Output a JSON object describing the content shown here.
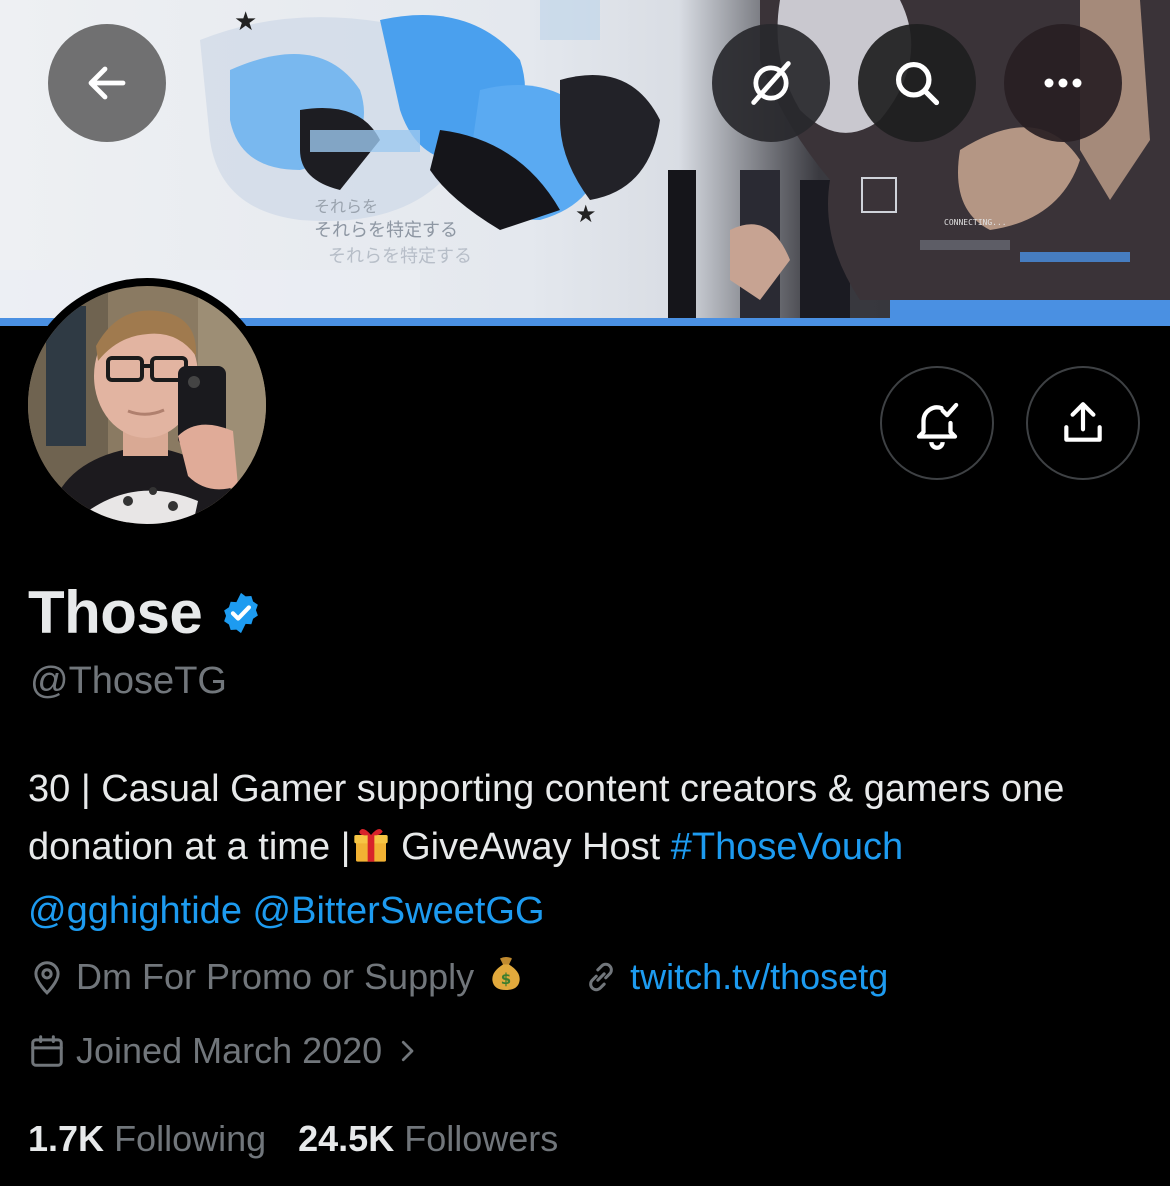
{
  "banner": {
    "graffiti_text": "THOSE",
    "japanese_lines": [
      "それらを",
      "それらを特定する",
      "それらを特定する"
    ],
    "connecting_text": "CONNECTING...",
    "accent_color": "#4a90e2"
  },
  "header_buttons": {
    "back": "arrow-left-icon",
    "grok": "grok-icon",
    "search": "search-icon",
    "more": "more-horizontal-icon"
  },
  "profile": {
    "display_name": "Those",
    "verified": true,
    "handle": "@ThoseTG",
    "bio": {
      "text1": "30 | Casual Gamer supporting content creators & gamers one donation at a time |",
      "text2": " GiveAway Host ",
      "hashtag": "#ThoseVouch",
      "mention1": "@gghightide",
      "mention2": "@BitterSweetGG"
    },
    "location": "Dm For Promo or Supply",
    "website": "twitch.tv/thosetg",
    "joined": "Joined March 2020"
  },
  "stats": {
    "following_count": "1.7K",
    "following_label": "Following",
    "followers_count": "24.5K",
    "followers_label": "Followers"
  },
  "colors": {
    "background": "#000000",
    "text_primary": "#e7e9ea",
    "text_secondary": "#71767b",
    "link": "#1d9bf0",
    "border": "#3e4144"
  }
}
